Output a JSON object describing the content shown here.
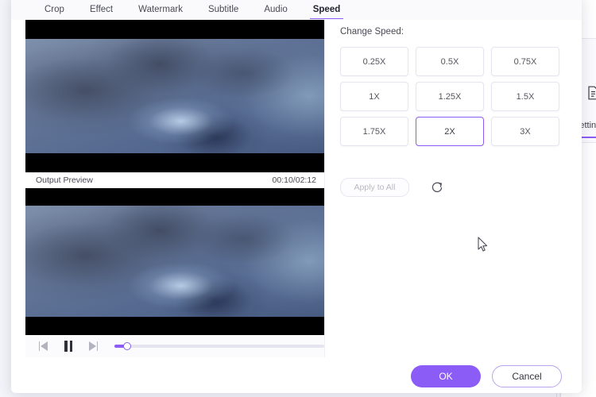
{
  "dialog": {
    "tabs": [
      {
        "label": "Crop",
        "active": false
      },
      {
        "label": "Effect",
        "active": false
      },
      {
        "label": "Watermark",
        "active": false
      },
      {
        "label": "Subtitle",
        "active": false
      },
      {
        "label": "Audio",
        "active": false
      },
      {
        "label": "Speed",
        "active": true
      }
    ],
    "preview": {
      "output_label": "Output Preview",
      "timestamp": "00:10/02:12",
      "playback": {
        "prev_frame_icon": "step-backward-icon",
        "pause_icon": "pause-icon",
        "next_frame_icon": "step-forward-icon",
        "progress_percent": 6
      }
    },
    "settings": {
      "section_title": "Change Speed:",
      "speeds": [
        {
          "label": "0.25X",
          "selected": false
        },
        {
          "label": "0.5X",
          "selected": false
        },
        {
          "label": "0.75X",
          "selected": false
        },
        {
          "label": "1X",
          "selected": false
        },
        {
          "label": "1.25X",
          "selected": false
        },
        {
          "label": "1.5X",
          "selected": false
        },
        {
          "label": "1.75X",
          "selected": false
        },
        {
          "label": "2X",
          "selected": true
        },
        {
          "label": "3X",
          "selected": false
        }
      ],
      "apply_to_all_label": "Apply to All",
      "reset_icon": "reset-circular-arrow-icon"
    },
    "footer": {
      "ok_label": "OK",
      "cancel_label": "Cancel"
    }
  },
  "background": {
    "panel_icon": "settings-document-icon",
    "panel_label": "Settings"
  },
  "colors": {
    "accent": "#8b5cf6",
    "accent_border": "#b9a4ef",
    "text": "#4a4a55",
    "muted_text": "#b8b8c2",
    "border": "#e4e5ee",
    "dialog_bg": "#ffffff",
    "tabbar_bg": "#fafafd",
    "app_bg": "#f4f5fa",
    "video_letterbox": "#000000"
  }
}
